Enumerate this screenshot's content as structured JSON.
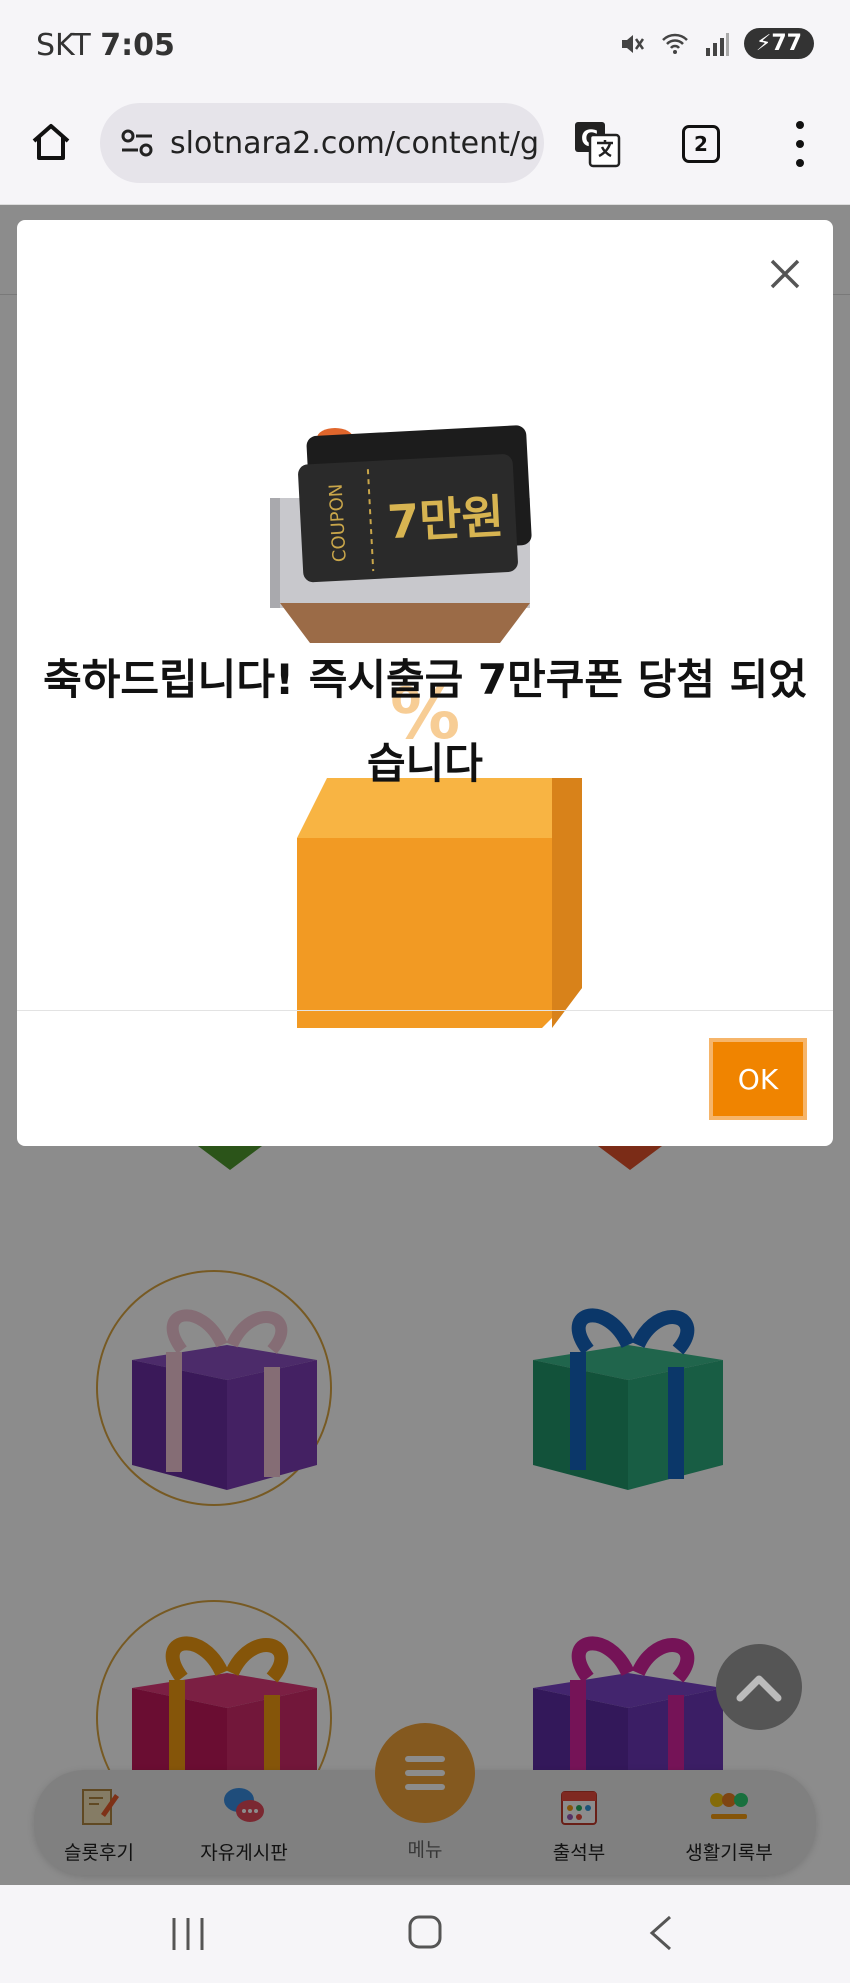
{
  "status_bar": {
    "carrier": "SKT",
    "time": "7:05",
    "battery": "77"
  },
  "browser": {
    "url": "slotnara2.com/content/g",
    "tab_count": "2"
  },
  "modal": {
    "coupon_label": "COUPON",
    "coupon_amount": "7만원",
    "title": "축하드립니다! 즉시출금 7만쿠폰 당첨 되었습니다",
    "ok_label": "OK"
  },
  "bottom_nav": {
    "items": [
      {
        "label": "슬롯후기"
      },
      {
        "label": "자유게시판"
      },
      {
        "label": "메뉴"
      },
      {
        "label": "출석부"
      },
      {
        "label": "생활기록부"
      }
    ]
  },
  "colors": {
    "accent": "#f08400",
    "menu_fab": "#f0a33a"
  }
}
